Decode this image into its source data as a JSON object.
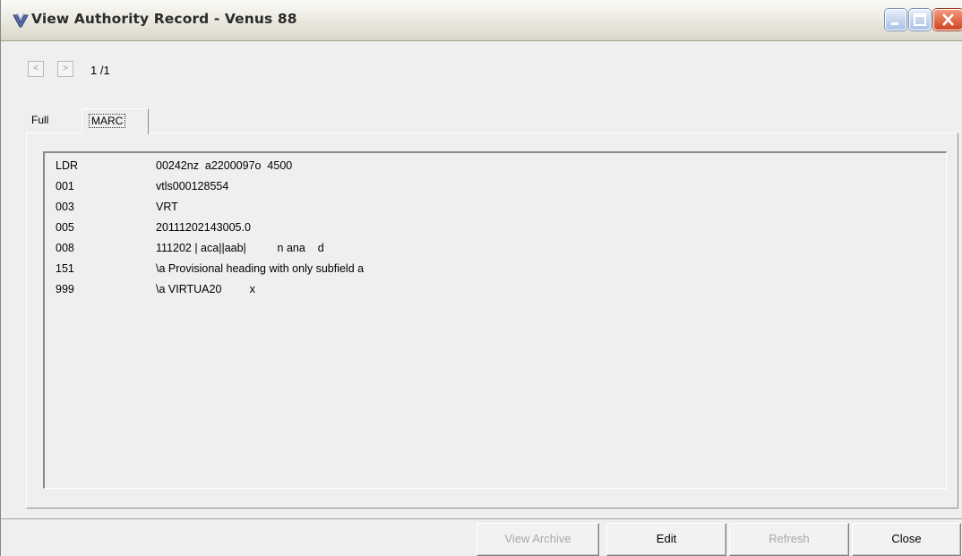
{
  "window": {
    "title": "View Authority Record - Venus 88"
  },
  "navigation": {
    "prev_label": "<",
    "next_label": ">",
    "record_count": "1 /1"
  },
  "tabs": [
    {
      "label": "Full",
      "selected": false
    },
    {
      "label": "MARC",
      "selected": true
    }
  ],
  "marc_fields": [
    {
      "tag": "LDR",
      "value": "00242nz  a2200097o  4500"
    },
    {
      "tag": "001",
      "value": "vtls000128554"
    },
    {
      "tag": "003",
      "value": "VRT"
    },
    {
      "tag": "005",
      "value": "20111202143005.0"
    },
    {
      "tag": "008",
      "value": "111202 | aca||aab|          n ana    d"
    },
    {
      "tag": "151",
      "value": "\\a Provisional heading with only subfield a"
    },
    {
      "tag": "999",
      "value": "\\a VIRTUA20         x"
    }
  ],
  "buttons": {
    "view_archive": "View Archive",
    "edit": "Edit",
    "refresh": "Refresh",
    "close": "Close"
  },
  "icons": {
    "app": "checkmark-shield-icon",
    "minimize": "minimize-icon",
    "maximize": "maximize-icon",
    "close": "close-icon"
  }
}
